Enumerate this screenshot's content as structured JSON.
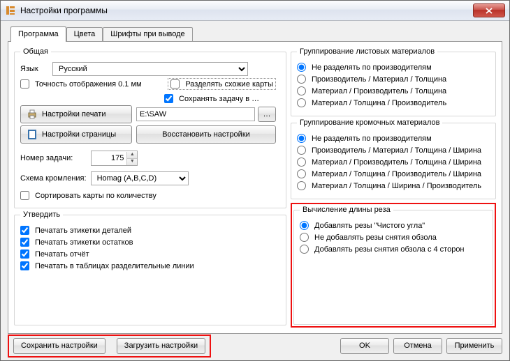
{
  "window": {
    "title": "Настройки программы"
  },
  "tabs": {
    "program": "Программа",
    "colors": "Цвета",
    "fonts": "Шрифты при выводе"
  },
  "general": {
    "legend": "Общая",
    "lang_label": "Язык",
    "lang_value": "Русский",
    "precision_label": "Точность отображения 0.1 мм",
    "split_maps_label": "Разделять схожие карты",
    "save_task_label": "Сохранять задачу в …",
    "print_settings_btn": "Настройки печати",
    "page_settings_btn": "Настройки страницы",
    "path_value": "E:\\SAW",
    "restore_btn": "Восстановить настройки",
    "task_no_label": "Номер задачи:",
    "task_no_value": "175",
    "edge_scheme_label": "Схема кромления:",
    "edge_scheme_value": "Homag (A,B,C,D)",
    "sort_maps_label": "Сортировать карты по количеству"
  },
  "confirm": {
    "legend": "Утвердить",
    "opt1": "Печатать этикетки деталей",
    "opt2": "Печатать этикетки остатков",
    "opt3": "Печатать отчёт",
    "opt4": "Печатать в таблицах разделительные линии"
  },
  "sheet_group": {
    "legend": "Группирование листовых материалов",
    "o1": "Не разделять по производителям",
    "o2": "Производитель / Материал / Толщина",
    "o3": "Материал / Производитель / Толщина",
    "o4": "Материал / Толщина / Производитель"
  },
  "edge_group": {
    "legend": "Группирование кромочных материалов",
    "o1": "Не разделять по производителям",
    "o2": "Производитель / Материал / Толщина / Ширина",
    "o3": "Материал / Производитель / Толщина / Ширина",
    "o4": "Материал / Толщина / Производитель / Ширина",
    "o5": "Материал / Толщина / Ширина / Производитель"
  },
  "cut_len": {
    "legend": "Вычисление длины реза",
    "o1": "Добавлять резы \"Чистого угла\"",
    "o2": "Не добавлять резы снятия обзола",
    "o3": "Добавлять резы снятия обзола с 4 сторон"
  },
  "buttons": {
    "save": "Сохранить настройки",
    "load": "Загрузить настройки",
    "ok": "OK",
    "cancel": "Отмена",
    "apply": "Применить",
    "browse": "…"
  }
}
